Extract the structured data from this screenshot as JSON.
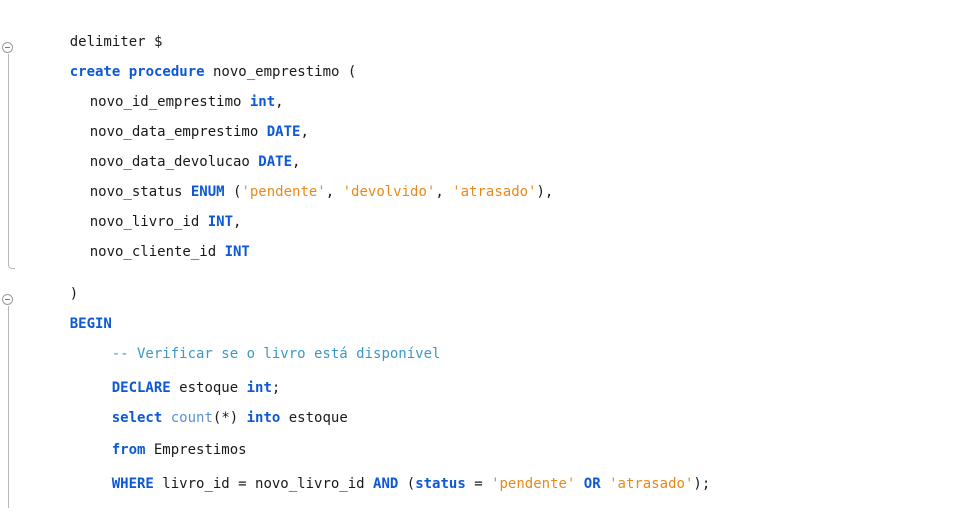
{
  "lines": {
    "l1": {
      "a": "delimiter $"
    },
    "l2": {
      "k1": "create procedure",
      "a": " novo_emprestimo ("
    },
    "l3": {
      "a": "novo_id_emprestimo ",
      "k1": "int",
      "b": ","
    },
    "l4": {
      "a": "novo_data_emprestimo ",
      "k1": "DATE",
      "b": ","
    },
    "l5": {
      "a": "novo_data_devolucao ",
      "k1": "DATE",
      "b": ","
    },
    "l6": {
      "a": "novo_status ",
      "k1": "ENUM",
      "b": " (",
      "s1": "'pendente'",
      "c": ", ",
      "s2": "'devolvido'",
      "d": ", ",
      "s3": "'atrasado'",
      "e": "),"
    },
    "l7": {
      "a": "novo_livro_id ",
      "k1": "INT",
      "b": ","
    },
    "l8": {
      "a": "novo_cliente_id ",
      "k1": "INT"
    },
    "l9": {
      "a": ")"
    },
    "l10": {
      "k1": "BEGIN"
    },
    "l11": {
      "cmt": "-- Verificar se o livro está disponível"
    },
    "l12": {
      "k1": "DECLARE",
      "a": " estoque ",
      "k2": "int",
      "b": ";"
    },
    "l13": {
      "k1": "select",
      "a": " ",
      "f1": "count",
      "b": "(*) ",
      "k2": "into",
      "c": " estoque"
    },
    "l14": {
      "k1": "from",
      "a": " Emprestimos"
    },
    "l15": {
      "k1": "WHERE",
      "a": " livro_id = novo_livro_id ",
      "k2": "AND",
      "b": " (",
      "k3": "status",
      "c": " = ",
      "s1": "'pendente'",
      "d": " ",
      "k4": "OR",
      "e": " ",
      "s2": "'atrasado'",
      "f": ");"
    }
  },
  "colors": {
    "keyword": "#0c58d6",
    "function": "#5a8fd6",
    "string": "#e8891a",
    "comment": "#3a9ac2"
  },
  "icons": {
    "fold_marker": "collapse-circle-minus-icon"
  }
}
